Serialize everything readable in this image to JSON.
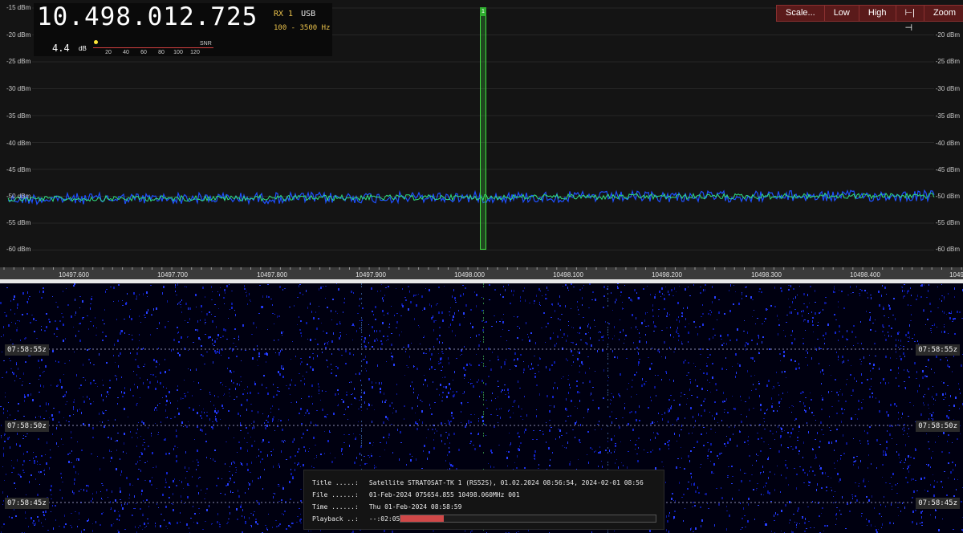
{
  "readout": {
    "frequency": "10.498.012.725",
    "rx": "RX 1",
    "mode": "USB",
    "bandwidth": "100 - 3500 Hz",
    "snr_value": "4.4",
    "snr_unit": "dB",
    "snr_label": "SNR",
    "snr_scale": [
      "20",
      "40",
      "60",
      "80",
      "100",
      "120"
    ]
  },
  "toolbar": {
    "scale": "Scale...",
    "low": "Low",
    "high": "High",
    "fit": "⊢|⊣",
    "zoom": "Zoom"
  },
  "spectrum": {
    "dbm_labels": [
      "-15 dBm",
      "-20 dBm",
      "-25 dBm",
      "-30 dBm",
      "-35 dBm",
      "-40 dBm",
      "-45 dBm",
      "-50 dBm",
      "-55 dBm",
      "-60 dBm"
    ],
    "noise_floor_dbm": -50.5,
    "marker_label": "1"
  },
  "freq_axis": {
    "labels": [
      "10497.600",
      "10497.700",
      "10497.800",
      "10497.900",
      "10498.000",
      "10498.100",
      "10498.200",
      "10498.300",
      "10498.400",
      "1049"
    ]
  },
  "waterfall": {
    "timestamps": [
      "07:58:55z",
      "07:58:50z",
      "07:58:45z"
    ]
  },
  "info": {
    "title_label": "Title .....:",
    "title_value": "Satellite STRATOSAT-TK 1 (RS52S),  01.02.2024 08:56:54, 2024-02-01 08:56",
    "file_label": "File ......:",
    "file_value": "01-Feb-2024 075654.855 10498.060MHz 001",
    "time_label": "Time ......:",
    "time_value": "Thu 01-Feb-2024 08:58:59",
    "playback_label": "Playback ..:",
    "playback_value": "--:02:05",
    "playback_progress": 0.17
  },
  "colors": {
    "trace_blue": "#1e50ff",
    "trace_green": "#30e080",
    "marker_green": "#40e040",
    "toolbar_bg": "#5a1a1a",
    "playback_fill": "#d04848"
  }
}
